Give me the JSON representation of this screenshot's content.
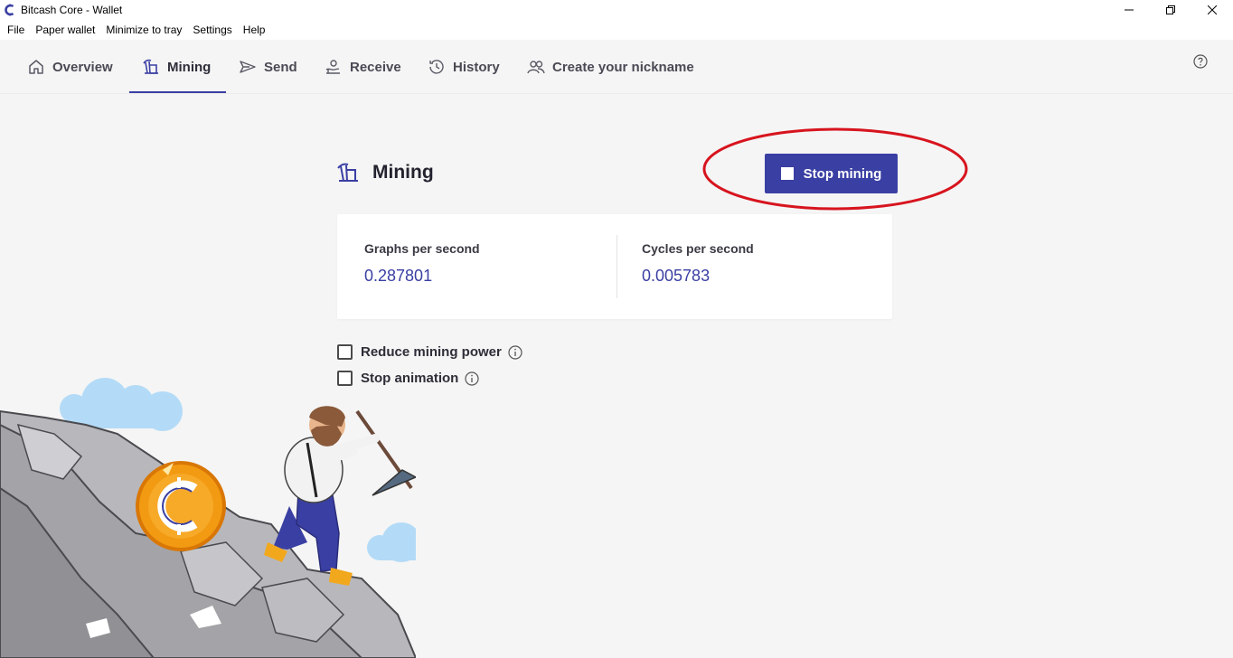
{
  "window": {
    "title": "Bitcash Core - Wallet",
    "controls": [
      "minimize-icon",
      "restore-icon",
      "close-icon"
    ]
  },
  "menu": {
    "items": [
      "File",
      "Paper wallet",
      "Minimize to tray",
      "Settings",
      "Help"
    ]
  },
  "nav": {
    "tabs": [
      {
        "label": "Overview",
        "icon": "home-icon"
      },
      {
        "label": "Mining",
        "icon": "mining-icon",
        "active": true
      },
      {
        "label": "Send",
        "icon": "send-icon"
      },
      {
        "label": "Receive",
        "icon": "receive-icon"
      },
      {
        "label": "History",
        "icon": "history-icon"
      },
      {
        "label": "Create your nickname",
        "icon": "users-icon"
      }
    ],
    "help_icon": "help-icon"
  },
  "mining": {
    "title": "Mining",
    "stop_button_label": "Stop mining",
    "stats": [
      {
        "label": "Graphs per second",
        "value": "0.287801"
      },
      {
        "label": "Cycles per second",
        "value": "0.005783"
      }
    ],
    "options": [
      {
        "label": "Reduce mining power",
        "checked": false
      },
      {
        "label": "Stop animation",
        "checked": false
      }
    ]
  },
  "colors": {
    "accent": "#3a3fa3",
    "annotation": "#d7141e",
    "background": "#f5f5f5"
  }
}
